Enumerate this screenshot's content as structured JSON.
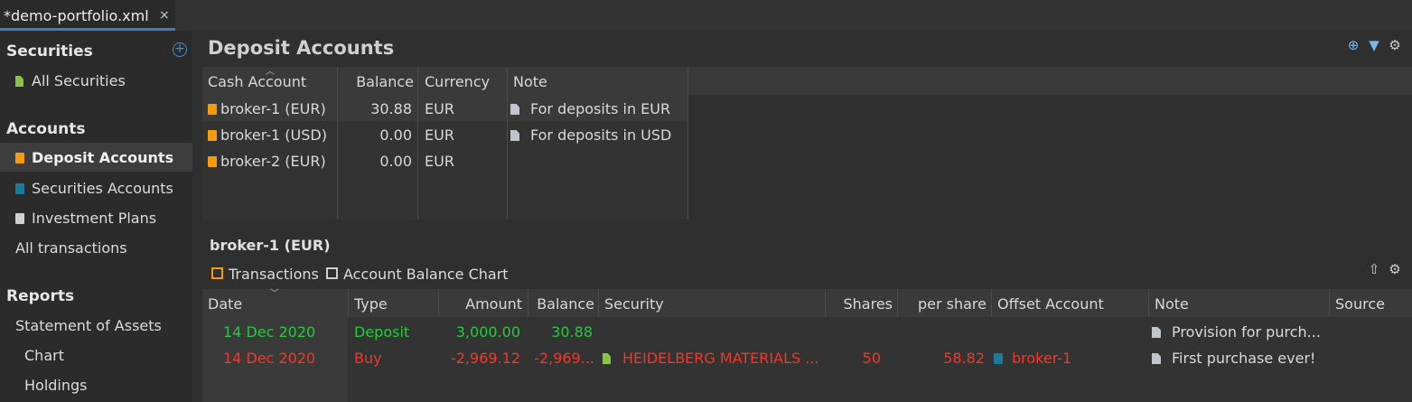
{
  "tab": {
    "title": "*demo-portfolio.xml",
    "close": "×"
  },
  "sidebar": {
    "securities_header": "Securities",
    "all_securities": "All Securities",
    "accounts_header": "Accounts",
    "deposit_accounts": "Deposit Accounts",
    "securities_accounts": "Securities Accounts",
    "investment_plans": "Investment Plans",
    "all_transactions": "All transactions",
    "reports_header": "Reports",
    "statement_of_assets": "Statement of Assets",
    "chart": "Chart",
    "holdings": "Holdings"
  },
  "main": {
    "title": "Deposit Accounts",
    "toolbar_icons": [
      "add-icon",
      "filter-icon",
      "gear-icon"
    ]
  },
  "accounts_table": {
    "headers": {
      "cash_account": "Cash Account",
      "balance": "Balance",
      "currency": "Currency",
      "note": "Note"
    },
    "rows": [
      {
        "name": "broker-1 (EUR)",
        "balance": "30.88",
        "currency": "EUR",
        "note": "For deposits in EUR"
      },
      {
        "name": "broker-1 (USD)",
        "balance": "0.00",
        "currency": "EUR",
        "note": "For deposits in USD"
      },
      {
        "name": "broker-2 (EUR)",
        "balance": "0.00",
        "currency": "EUR",
        "note": ""
      }
    ]
  },
  "detail": {
    "title": "broker-1 (EUR)",
    "tab_transactions": "Transactions",
    "tab_chart": "Account Balance Chart",
    "headers": {
      "date": "Date",
      "type": "Type",
      "amount": "Amount",
      "balance": "Balance",
      "security": "Security",
      "shares": "Shares",
      "per_share": "per share",
      "offset_account": "Offset Account",
      "note": "Note",
      "source": "Source"
    },
    "rows": [
      {
        "date": "14 Dec 2020",
        "type": "Deposit",
        "amount": "3,000.00",
        "balance": "30.88",
        "security": "",
        "shares": "",
        "per_share": "",
        "offset": "",
        "note": "Provision for purch..."
      },
      {
        "date": "14 Dec 2020",
        "type": "Buy",
        "amount": "-2,969.12",
        "balance": "-2,969...",
        "security": "HEIDELBERG MATERIALS ...",
        "shares": "50",
        "per_share": "58.82",
        "offset": "broker-1",
        "note": "First purchase ever!"
      }
    ]
  },
  "colors": {
    "accent": "#3d7fc4",
    "deposit_icon": "#f39c12",
    "securities_icon": "#1b7a9c",
    "green": "#27c93f",
    "red": "#f0392b"
  }
}
